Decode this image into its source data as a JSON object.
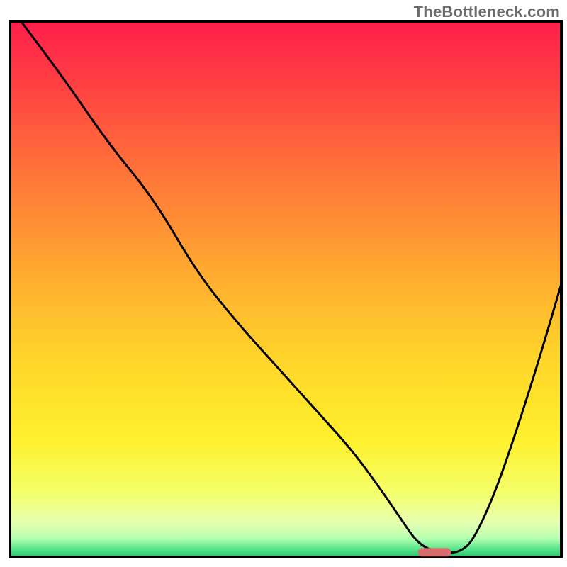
{
  "watermark": "TheBottleneck.com",
  "chart_data": {
    "type": "line",
    "title": "",
    "xlabel": "",
    "ylabel": "",
    "xlim": [
      0,
      100
    ],
    "ylim": [
      0,
      100
    ],
    "background_gradient": {
      "stops": [
        {
          "offset": 0.0,
          "color": "#ff1f4b"
        },
        {
          "offset": 0.1,
          "color": "#ff3a44"
        },
        {
          "offset": 0.25,
          "color": "#ff6a3a"
        },
        {
          "offset": 0.45,
          "color": "#ffa531"
        },
        {
          "offset": 0.62,
          "color": "#ffd32a"
        },
        {
          "offset": 0.78,
          "color": "#fff02c"
        },
        {
          "offset": 0.88,
          "color": "#f4ff6a"
        },
        {
          "offset": 0.935,
          "color": "#e6ffb0"
        },
        {
          "offset": 0.965,
          "color": "#b7ffb0"
        },
        {
          "offset": 0.985,
          "color": "#57e58a"
        },
        {
          "offset": 1.0,
          "color": "#27c46c"
        }
      ]
    },
    "series": [
      {
        "name": "bottleneck-curve",
        "color": "#000000",
        "x": [
          2,
          10,
          18,
          26,
          34,
          41,
          48,
          55,
          62,
          67,
          71,
          73.5,
          76,
          79,
          81.5,
          84,
          88,
          92,
          96,
          100
        ],
        "values": [
          100,
          89,
          77,
          67,
          53,
          44,
          36,
          28,
          20,
          13,
          7,
          3.2,
          1.3,
          0.8,
          0.9,
          3,
          12,
          24,
          37,
          51
        ]
      }
    ],
    "marker": {
      "name": "optimal-range",
      "x_start": 74,
      "x_end": 80,
      "y": 0.9,
      "color": "#d96c6c"
    }
  }
}
